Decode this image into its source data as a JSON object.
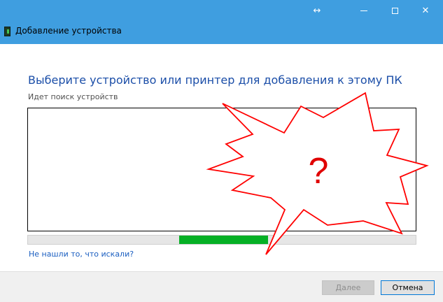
{
  "window": {
    "title": "Добавление устройства",
    "resize_glyph": "↔",
    "close_glyph": "✕"
  },
  "main": {
    "heading": "Выберите устройство или принтер для добавления к этому ПК",
    "status": "Идет поиск устройств",
    "progress": {
      "start_fraction": 0.39,
      "end_fraction": 0.62,
      "color": "#06b025"
    },
    "help_link": "Не нашли то, что искали?"
  },
  "footer": {
    "next_label": "Далее",
    "cancel_label": "Отмена"
  },
  "annotation": {
    "glyph": "?",
    "outline_color": "#ff0000",
    "text_color": "#e00000"
  },
  "colors": {
    "titlebar": "#3f9ee0",
    "heading": "#1b4ea8",
    "link": "#1a5ec0"
  }
}
